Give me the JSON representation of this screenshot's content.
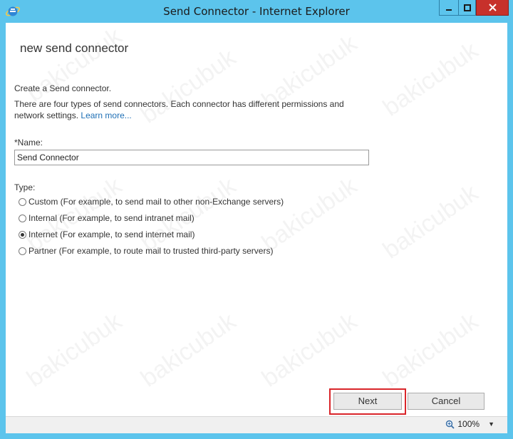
{
  "window": {
    "title": "Send Connector - Internet Explorer",
    "icon": "internet-explorer-icon"
  },
  "page": {
    "heading": "new send connector",
    "intro": "Create a Send connector.",
    "description": "There are four types of send connectors. Each connector has different permissions and network settings.",
    "learn_more": "Learn more..."
  },
  "form": {
    "name_label": "*Name:",
    "name_value": "Send Connector",
    "type_label": "Type:",
    "types": [
      {
        "label": "Custom (For example, to send mail to other non-Exchange servers)",
        "checked": false
      },
      {
        "label": "Internal (For example, to send intranet mail)",
        "checked": false
      },
      {
        "label": "Internet (For example, to send internet mail)",
        "checked": true
      },
      {
        "label": "Partner (For example, to route mail to trusted third-party servers)",
        "checked": false
      }
    ]
  },
  "buttons": {
    "next": "Next",
    "cancel": "Cancel"
  },
  "status": {
    "zoom": "100%"
  },
  "watermark": "bakicubuk",
  "colors": {
    "titlebar": "#5cc4ec",
    "close_button": "#c7312b",
    "link": "#1e6fb5",
    "highlight_frame": "#d9252a"
  }
}
